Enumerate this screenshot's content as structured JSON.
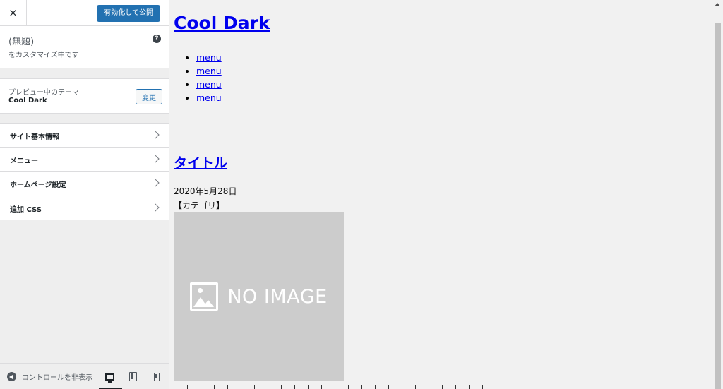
{
  "sidebar": {
    "close_icon": "×",
    "publish_label": "有効化して公開",
    "info": {
      "site_title": "(無題)",
      "customizing_label": "をカスタマイズ中です",
      "help_icon": "?"
    },
    "theme": {
      "previewing_label": "プレビュー中のテーマ",
      "name": "Cool Dark",
      "change_label": "変更"
    },
    "panels": [
      {
        "label": "サイト基本情報"
      },
      {
        "label": "メニュー"
      },
      {
        "label": "ホームページ設定"
      },
      {
        "label": "追加 CSS"
      }
    ],
    "footer": {
      "collapse_label": "コントロールを非表示",
      "devices": [
        "desktop-icon",
        "tablet-icon",
        "mobile-icon"
      ]
    }
  },
  "preview": {
    "site_title": "Cool Dark",
    "menu_items": [
      "menu",
      "menu",
      "menu",
      "menu"
    ],
    "post": {
      "title": "タイトル",
      "date": "2020年5月28日",
      "category": "【カテゴリ】",
      "placeholder_text": "NO IMAGE"
    }
  },
  "colors": {
    "primary": "#2271b1",
    "link": "#0000ee",
    "placeholder_bg": "#cccccc"
  }
}
